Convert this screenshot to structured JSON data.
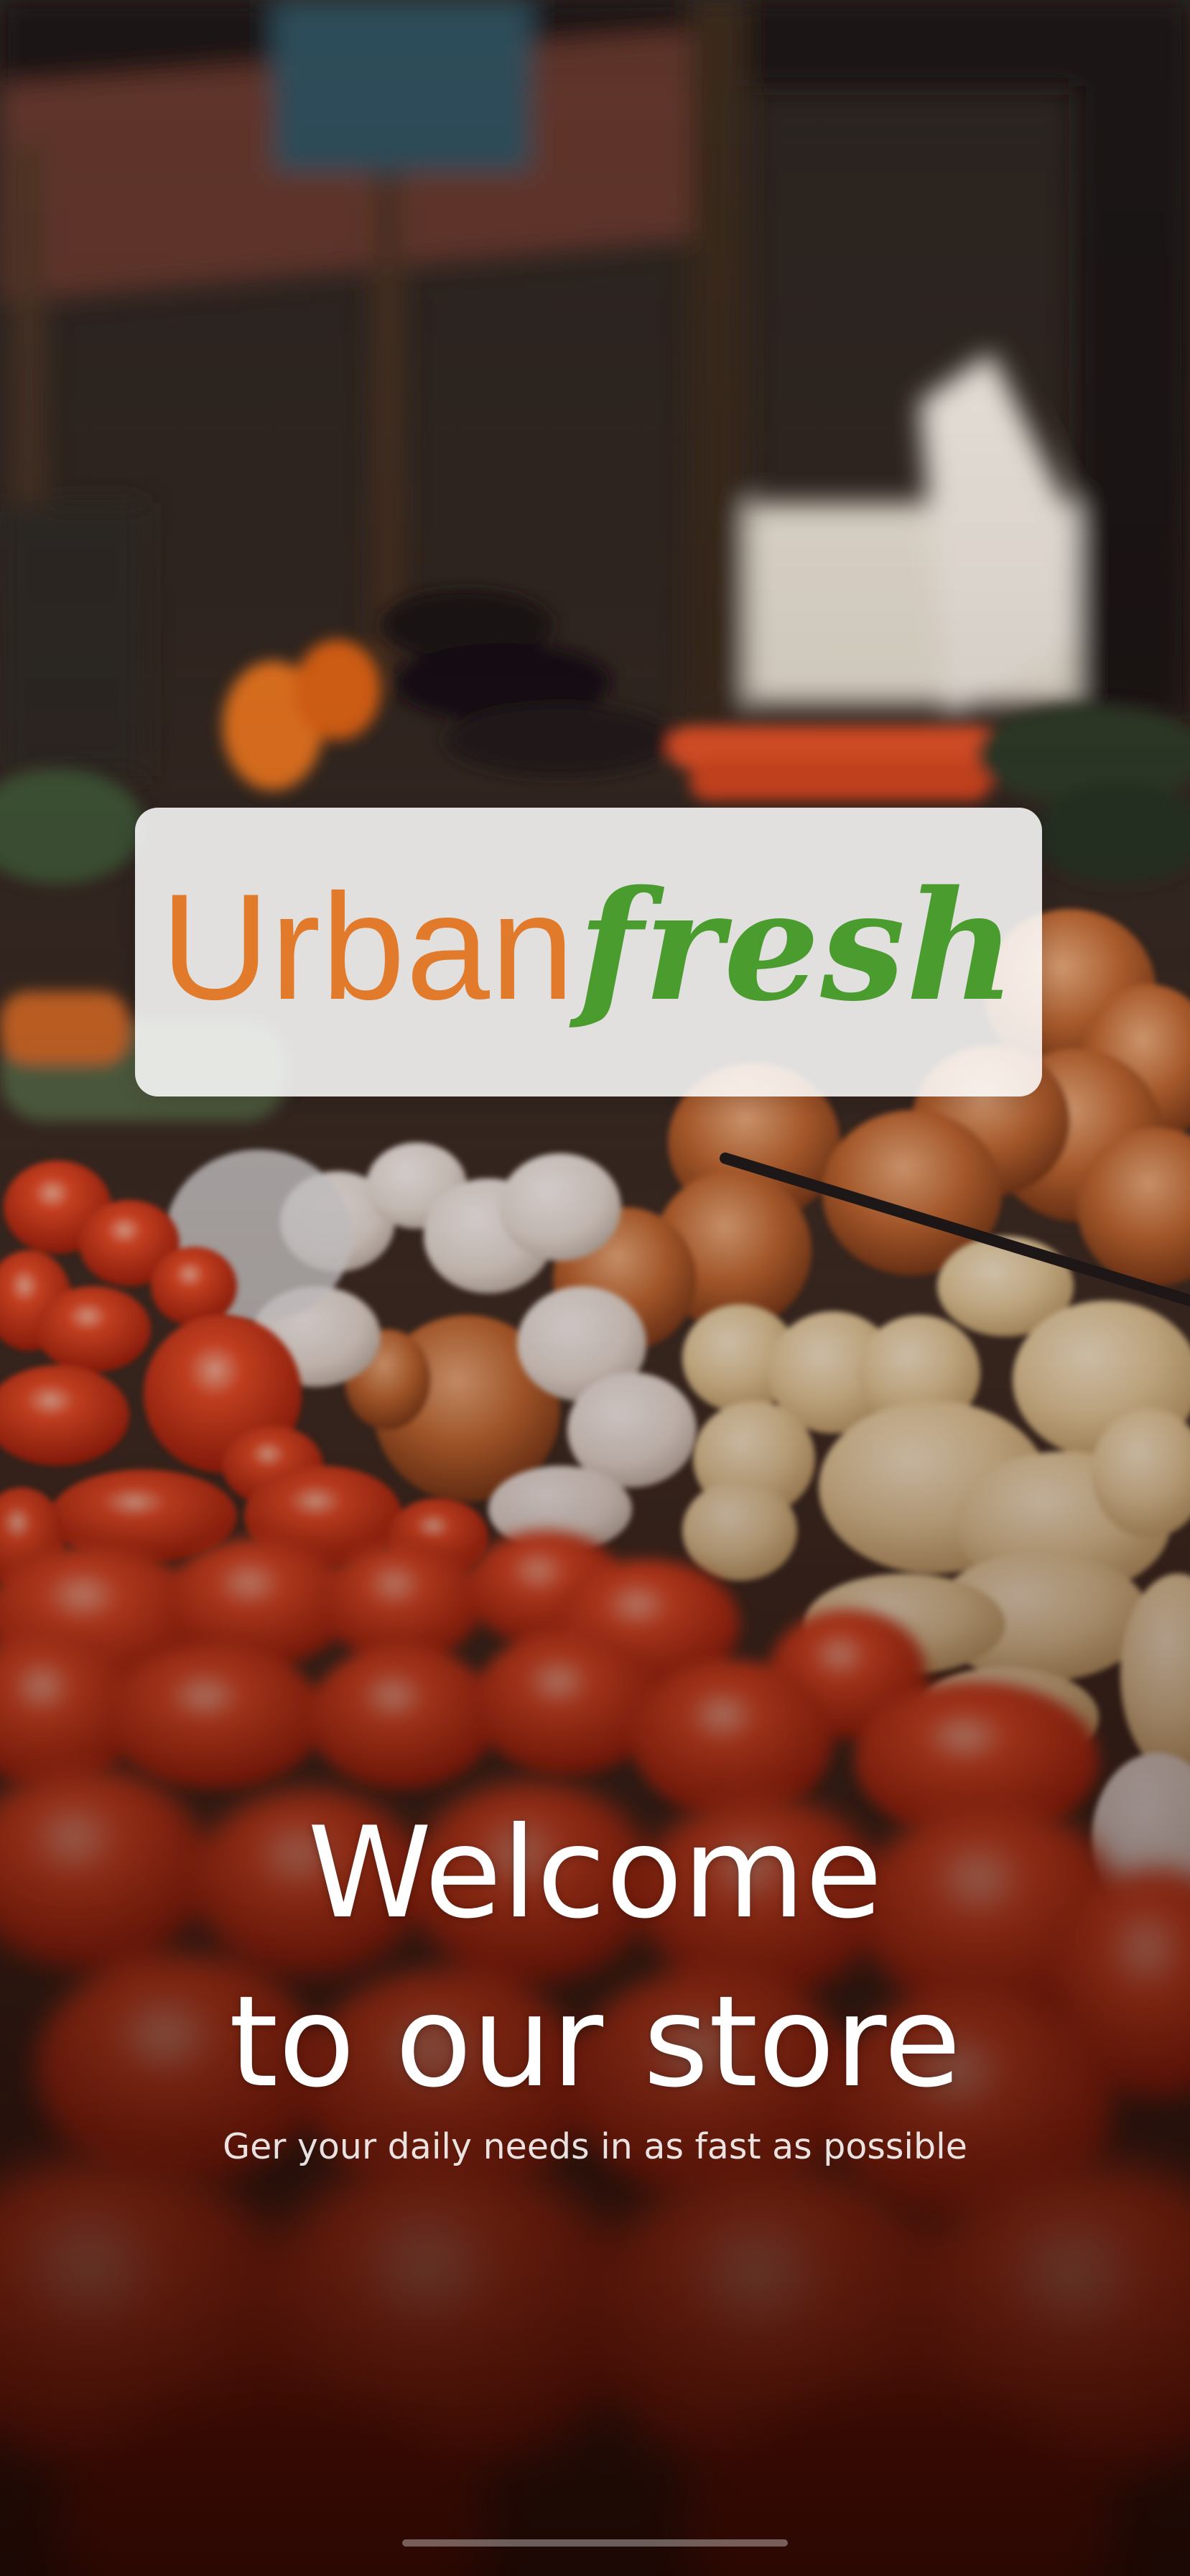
{
  "logo": {
    "part1": "Urban",
    "part2": "fresh",
    "color_part1": "#e27a2b",
    "color_part2": "#4a9c2f"
  },
  "welcome": {
    "line1": "Welcome",
    "line2": "to our store"
  },
  "subtitle": "Ger your daily needs in as fast as possible",
  "background": {
    "icon": "vegetable-market-photo"
  }
}
